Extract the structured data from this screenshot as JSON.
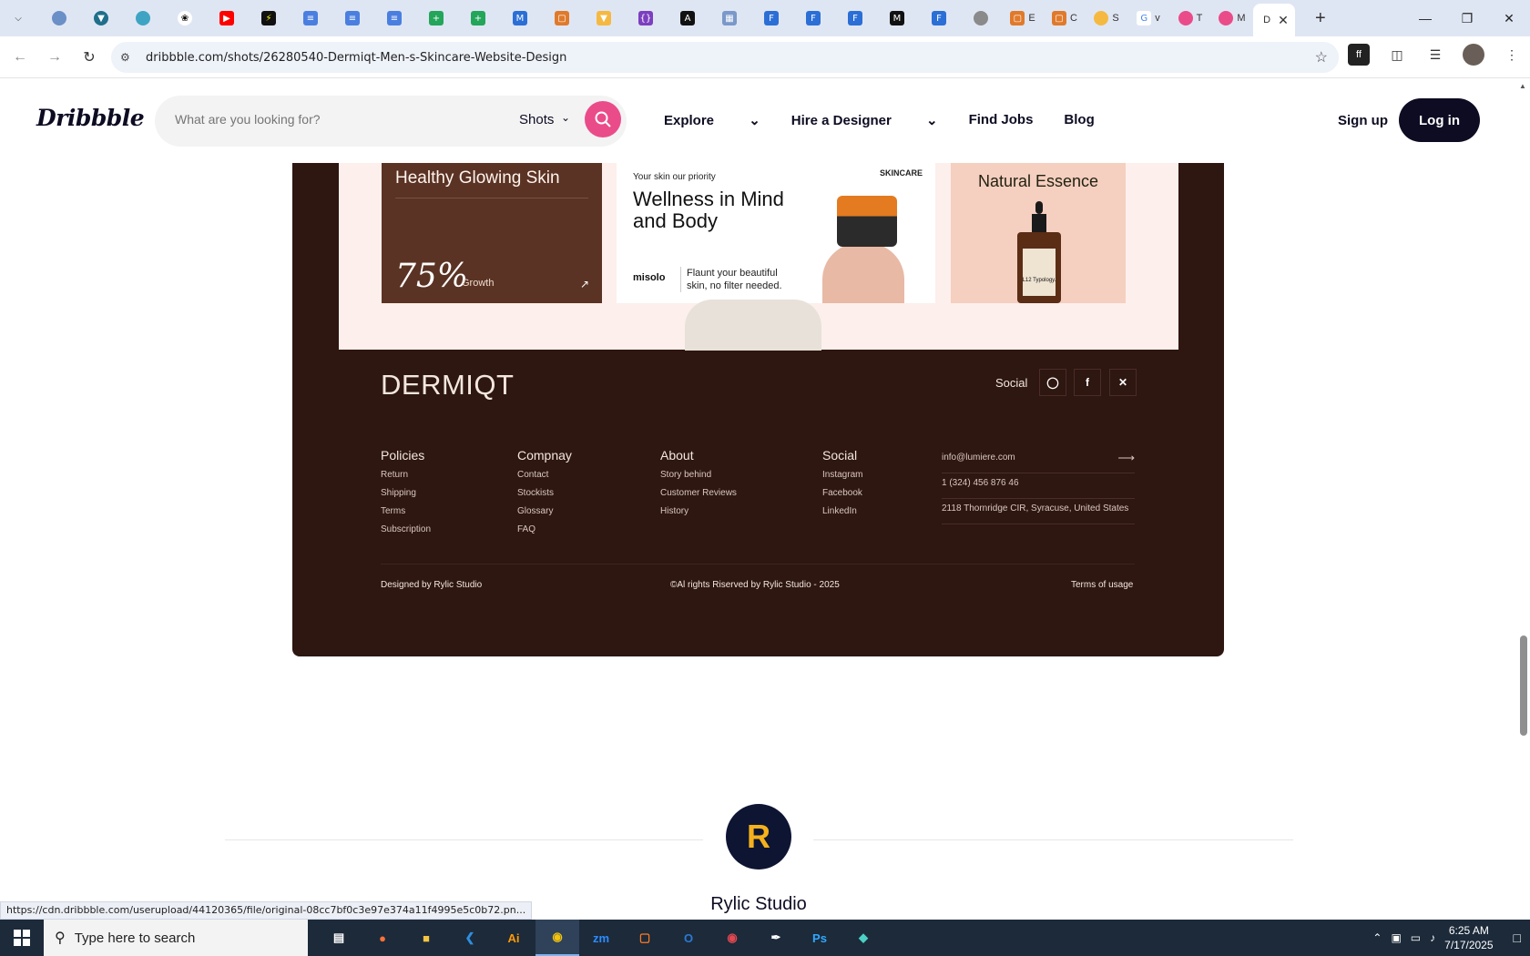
{
  "browser": {
    "active_tab_title": "D",
    "tab_titles": [
      "E",
      "C",
      "S",
      "v",
      "T",
      "M"
    ],
    "url": "dribbble.com/shots/26280540-Dermiqt-Men-s-Skincare-Website-Design",
    "status_url": "https://cdn.dribbble.com/userupload/44120365/file/original-08cc7bf0c3e97e374a11f4995e5c0b72.pn..."
  },
  "header": {
    "logo": "Dribbble",
    "search_placeholder": "What are you looking for?",
    "search_scope": "Shots",
    "nav": [
      "Explore",
      "Hire a Designer",
      "Find Jobs",
      "Blog"
    ],
    "signup": "Sign up",
    "login": "Log in"
  },
  "shot": {
    "card1": {
      "title": "Healthy Glowing Skin",
      "percent": "75%",
      "label": "Growth"
    },
    "card2": {
      "subtitle": "Your skin our priority",
      "headline": "Wellness in Mind and Body",
      "brand": "misolo",
      "tagline": "Flaunt your beautiful skin, no filter needed.",
      "badge": "SKINCARE"
    },
    "card3": {
      "title": "Natural Essence",
      "bottle_label": "L12 Typology."
    },
    "footer": {
      "logo": "DERMIQT",
      "social_label": "Social",
      "columns": [
        {
          "heading": "Policies",
          "items": [
            "Return",
            "Shipping",
            "Terms",
            "Subscription"
          ]
        },
        {
          "heading": "Compnay",
          "items": [
            "Contact",
            "Stockists",
            "Glossary",
            "FAQ"
          ]
        },
        {
          "heading": "About",
          "items": [
            "Story behind",
            "Customer Reviews",
            "History"
          ]
        },
        {
          "heading": "Social",
          "items": [
            "Instagram",
            "Facebook",
            "LinkedIn"
          ]
        }
      ],
      "contact": [
        "info@lumiere.com",
        "1 (324) 456 876 46",
        "2118 Thornridge CIR, Syracuse, United States"
      ],
      "designed_by": "Designed by Rylic Studio",
      "copyright": "©Al rights Riserved by Rylic Studio - 2025",
      "terms": "Terms of usage"
    }
  },
  "author": {
    "name": "Rylic Studio",
    "initial": "R"
  },
  "taskbar": {
    "search_placeholder": "Type here to search",
    "time": "6:25 AM",
    "date": "7/17/2025"
  }
}
